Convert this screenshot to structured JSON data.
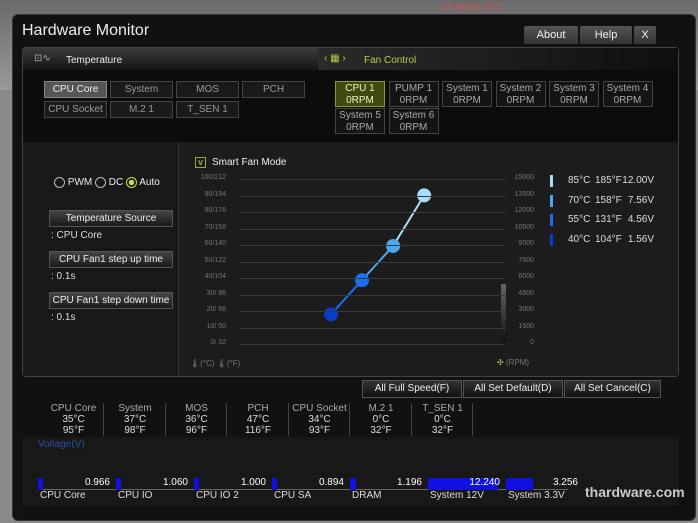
{
  "window": {
    "title": "Hardware Monitor",
    "about": "About",
    "help": "Help",
    "close": "X"
  },
  "background": {
    "ez_mode": "EZ Mode (F7)"
  },
  "temperature": {
    "label": "Temperature",
    "sensors": [
      "CPU Core",
      "System",
      "MOS",
      "PCH",
      "CPU Socket",
      "M.2 1",
      "T_SEN 1"
    ],
    "selected": "CPU Core"
  },
  "fan_control": {
    "label": "Fan Control",
    "fans": [
      {
        "name": "CPU 1",
        "rpm": "0RPM",
        "selected": true
      },
      {
        "name": "PUMP 1",
        "rpm": "0RPM"
      },
      {
        "name": "System 1",
        "rpm": "0RPM"
      },
      {
        "name": "System 2",
        "rpm": "0RPM"
      },
      {
        "name": "System 3",
        "rpm": "0RPM"
      },
      {
        "name": "System 4",
        "rpm": "0RPM"
      },
      {
        "name": "System 5",
        "rpm": "0RPM"
      },
      {
        "name": "System 6",
        "rpm": "0RPM"
      }
    ]
  },
  "mode": {
    "pwm": "PWM",
    "dc": "DC",
    "auto": "Auto",
    "selected": "Auto"
  },
  "settings": {
    "temp_source_label": "Temperature Source",
    "temp_source_value": ": CPU Core",
    "step_up_label": "CPU Fan1 step up time",
    "step_up_value": ": 0.1s",
    "step_down_label": "CPU Fan1 step down time",
    "step_down_value": ": 0.1s"
  },
  "chart_data": {
    "type": "line",
    "title": "Smart Fan Mode",
    "smart_fan_checked": true,
    "left_ticks": [
      "0/ 32",
      "10/ 50",
      "20/ 68",
      "30/ 86",
      "40/104",
      "50/122",
      "60/140",
      "70/158",
      "80/176",
      "90/194",
      "100/212"
    ],
    "right_ticks": [
      "0",
      "1500",
      "3000",
      "4500",
      "6000",
      "7500",
      "9000",
      "10500",
      "12000",
      "13500",
      "15000"
    ],
    "left_unit_c": "(°C)",
    "left_unit_f": "(°F)",
    "right_unit": "(RPM)",
    "points": [
      {
        "c": "40°C",
        "f": "104°F",
        "v": "1.56V",
        "temp": 40,
        "volt": 1.56,
        "color": "#0a3ccc"
      },
      {
        "c": "55°C",
        "f": "131°F",
        "v": "4.56V",
        "temp": 55,
        "volt": 4.56,
        "color": "#1e6ef0"
      },
      {
        "c": "70°C",
        "f": "158°F",
        "v": "7.56V",
        "temp": 70,
        "volt": 7.56,
        "color": "#4aa8f0"
      },
      {
        "c": "85°C",
        "f": "185°F",
        "v": "12.00V",
        "temp": 85,
        "volt": 12.0,
        "color": "#a8dcf8"
      }
    ]
  },
  "actions": {
    "full_speed": "All Full Speed(F)",
    "set_default": "All Set Default(D)",
    "set_cancel": "All Set Cancel(C)"
  },
  "readings": [
    {
      "name": "CPU Core",
      "c": "35°C",
      "f": "95°F"
    },
    {
      "name": "System",
      "c": "37°C",
      "f": "98°F"
    },
    {
      "name": "MOS",
      "c": "36°C",
      "f": "96°F"
    },
    {
      "name": "PCH",
      "c": "47°C",
      "f": "116°F"
    },
    {
      "name": "CPU Socket",
      "c": "34°C",
      "f": "93°F"
    },
    {
      "name": "M.2 1",
      "c": "0°C",
      "f": "32°F"
    },
    {
      "name": "T_SEN 1",
      "c": "0°C",
      "f": "32°F"
    }
  ],
  "voltage": {
    "label": "Voltage(V)",
    "items": [
      {
        "name": "CPU Core",
        "value": "0.966",
        "fill": 0.06
      },
      {
        "name": "CPU IO",
        "value": "1.060",
        "fill": 0.07
      },
      {
        "name": "CPU IO 2",
        "value": "1.000",
        "fill": 0.07
      },
      {
        "name": "CPU SA",
        "value": "0.894",
        "fill": 0.06
      },
      {
        "name": "DRAM",
        "value": "1.196",
        "fill": 0.08
      },
      {
        "name": "System 12V",
        "value": "12.240",
        "fill": 0.9
      },
      {
        "name": "System 3.3V",
        "value": "3.256",
        "fill": 0.35
      }
    ]
  },
  "watermark": "thardware.com"
}
